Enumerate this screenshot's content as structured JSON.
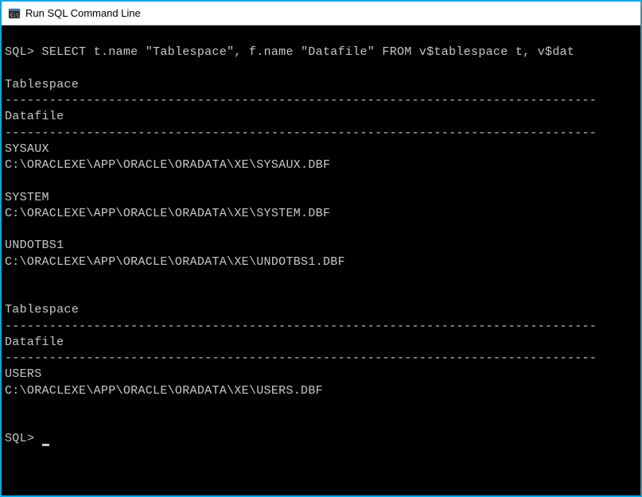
{
  "window": {
    "title": "Run SQL Command Line"
  },
  "terminal": {
    "prompt": "SQL>",
    "command": "SELECT t.name \"Tablespace\", f.name \"Datafile\" FROM v$tablespace t, v$dat",
    "header1": "Tablespace",
    "header2": "Datafile",
    "dashes": "--------------------------------------------------------------------------------",
    "rows": [
      {
        "tablespace": "SYSAUX",
        "datafile": "C:\\ORACLEXE\\APP\\ORACLE\\ORADATA\\XE\\SYSAUX.DBF"
      },
      {
        "tablespace": "SYSTEM",
        "datafile": "C:\\ORACLEXE\\APP\\ORACLE\\ORADATA\\XE\\SYSTEM.DBF"
      },
      {
        "tablespace": "UNDOTBS1",
        "datafile": "C:\\ORACLEXE\\APP\\ORACLE\\ORADATA\\XE\\UNDOTBS1.DBF"
      }
    ],
    "rows2": [
      {
        "tablespace": "USERS",
        "datafile": "C:\\ORACLEXE\\APP\\ORACLE\\ORADATA\\XE\\USERS.DBF"
      }
    ]
  }
}
